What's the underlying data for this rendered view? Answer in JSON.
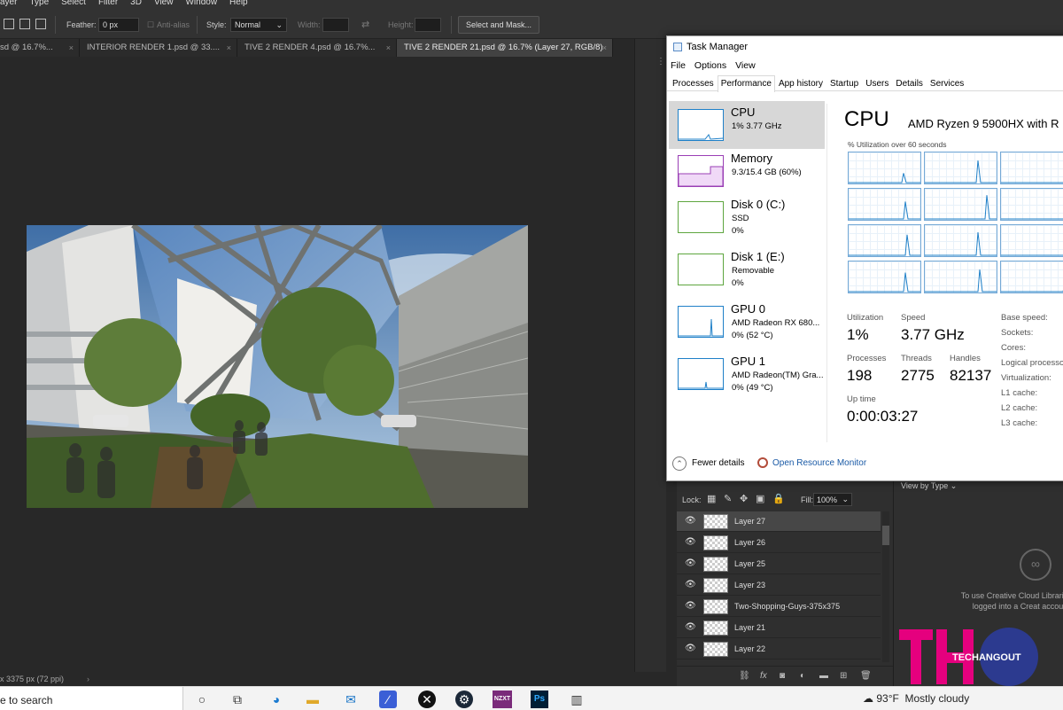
{
  "photoshop": {
    "menu": [
      "ayer",
      "Type",
      "Select",
      "Filter",
      "3D",
      "View",
      "Window",
      "Help"
    ],
    "options": {
      "feather_label": "Feather:",
      "feather_value": "0 px",
      "antialias_label": "Anti-alias",
      "style_label": "Style:",
      "style_value": "Normal",
      "width_label": "Width:",
      "height_label": "Height:",
      "select_mask_label": "Select and Mask..."
    },
    "tabs": [
      {
        "label": "sd @ 16.7%..."
      },
      {
        "label": "INTERIOR RENDER 1.psd @ 33...."
      },
      {
        "label": "TIVE 2 RENDER 4.psd @ 16.7%..."
      },
      {
        "label": "TIVE 2 RENDER 21.psd @ 16.7% (Layer 27, RGB/8)",
        "active": true
      }
    ],
    "status_text": "x 3375 px (72 ppi)",
    "layers_panel": {
      "lock_label": "Lock:",
      "fill_label": "Fill:",
      "fill_value": "100%",
      "layers": [
        "Layer 27",
        "Layer 26",
        "Layer 25",
        "Layer 23",
        "Two-Shopping-Guys-375x375",
        "Layer 21",
        "Layer 22"
      ]
    },
    "libraries_panel": {
      "view_by": "View by Type",
      "message": "To use Creative Cloud Librari to be logged into a Creat account."
    }
  },
  "task_manager": {
    "title": "Task Manager",
    "menu": [
      "File",
      "Options",
      "View"
    ],
    "tabs": [
      "Processes",
      "Performance",
      "App history",
      "Startup",
      "Users",
      "Details",
      "Services"
    ],
    "active_tab": "Performance",
    "sidebar": [
      {
        "name": "CPU",
        "line2": "1% 3.77 GHz",
        "line3": "",
        "color": "#1f80c8"
      },
      {
        "name": "Memory",
        "line2": "9.3/15.4 GB (60%)",
        "line3": "",
        "color": "#9a3fb5"
      },
      {
        "name": "Disk 0 (C:)",
        "line2": "SSD",
        "line3": "0%",
        "color": "#5ea63f"
      },
      {
        "name": "Disk 1 (E:)",
        "line2": "Removable",
        "line3": "0%",
        "color": "#5ea63f"
      },
      {
        "name": "GPU 0",
        "line2": "AMD Radeon RX 680...",
        "line3": "0% (52 °C)",
        "color": "#1f80c8"
      },
      {
        "name": "GPU 1",
        "line2": "AMD Radeon(TM) Gra...",
        "line3": "0% (49 °C)",
        "color": "#1f80c8"
      }
    ],
    "cpu": {
      "heading": "CPU",
      "model": "AMD Ryzen 9 5900HX with R",
      "util_label": "% Utilization over 60 seconds",
      "stats": {
        "utilization_label": "Utilization",
        "utilization": "1%",
        "speed_label": "Speed",
        "speed": "3.77 GHz",
        "processes_label": "Processes",
        "processes": "198",
        "threads_label": "Threads",
        "threads": "2775",
        "handles_label": "Handles",
        "handles": "82137",
        "uptime_label": "Up time",
        "uptime": "0:00:03:27"
      },
      "specs": [
        "Base speed:",
        "Sockets:",
        "Cores:",
        "Logical processo",
        "Virtualization:",
        "L1 cache:",
        "L2 cache:",
        "L3 cache:"
      ]
    },
    "footer": {
      "fewer_details": "Fewer details",
      "resource_monitor": "Open Resource Monitor"
    }
  },
  "taskbar": {
    "search_text": "e to search",
    "weather_temp": "93°F",
    "weather_desc": "Mostly cloudy"
  },
  "watermark": {
    "logo_text": "TECHANGOUT"
  }
}
